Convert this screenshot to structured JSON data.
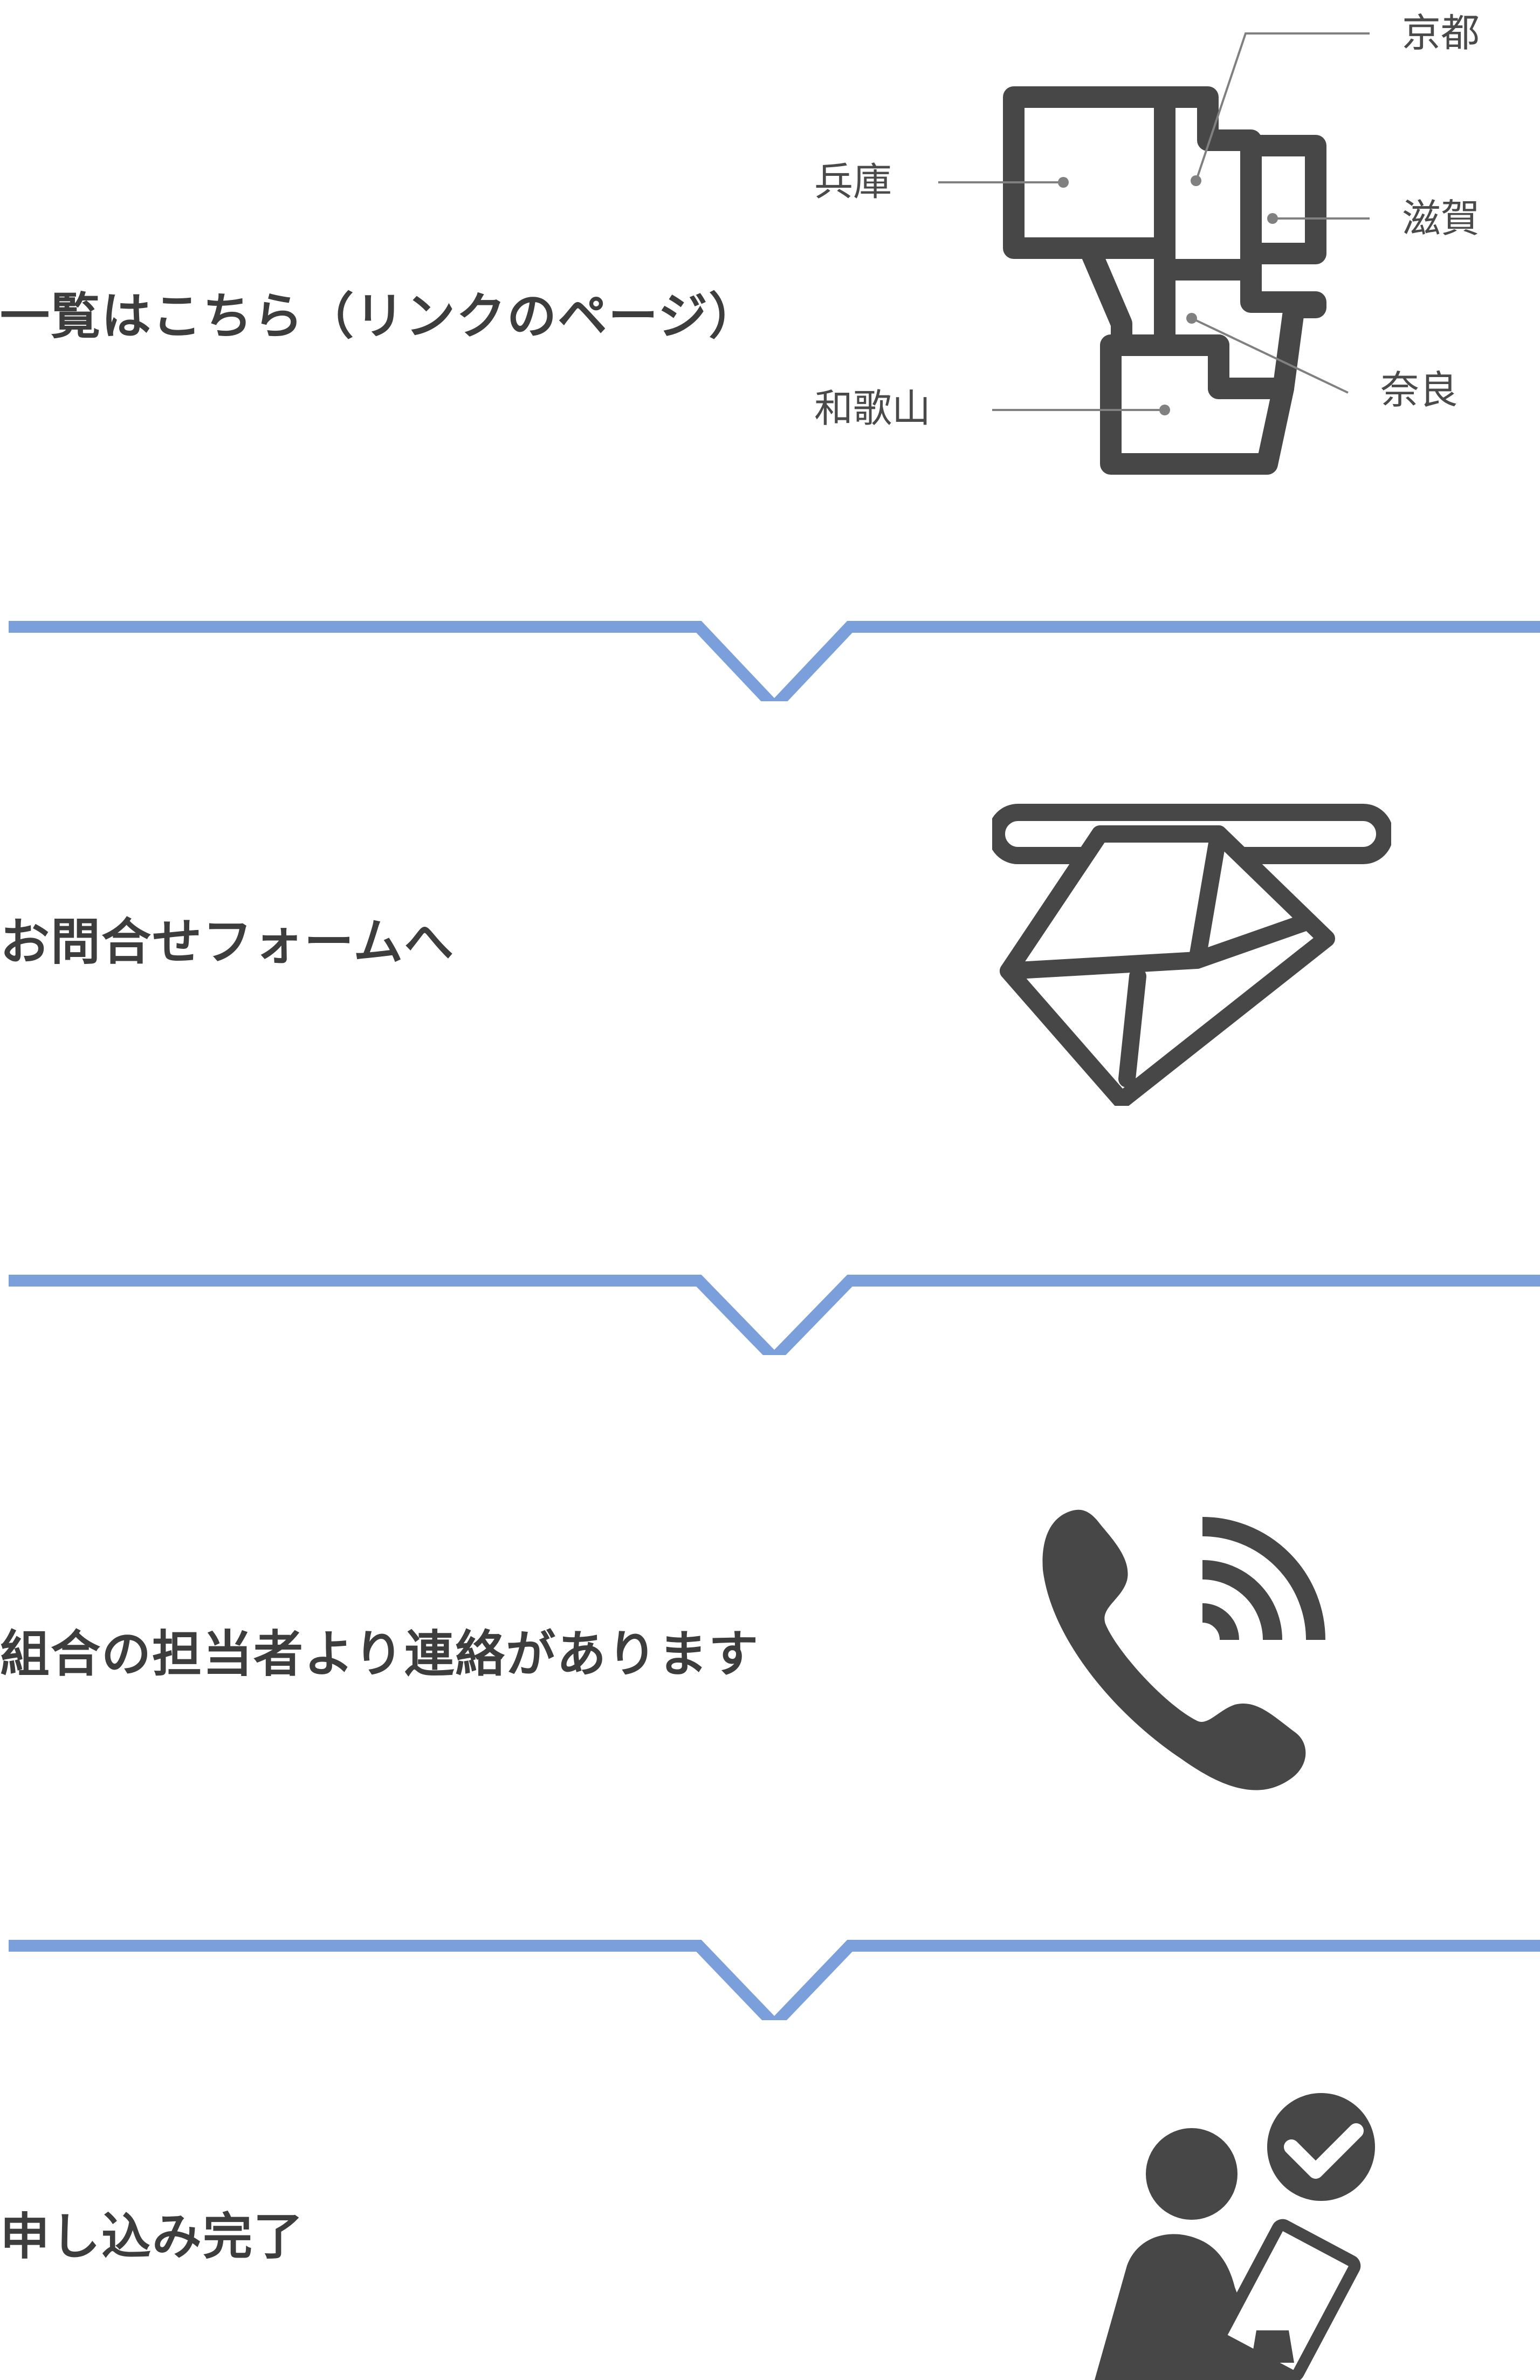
{
  "steps": [
    {
      "label": "一覧はこちら（リンクのページ）",
      "icon": "kansai-map-icon"
    },
    {
      "label": "お問合せフォームへ",
      "icon": "envelope-icon"
    },
    {
      "label": "組合の担当者より連絡があります",
      "icon": "phone-icon"
    },
    {
      "label": "申し込み完了",
      "icon": "person-checklist-icon"
    }
  ],
  "map": {
    "labels": {
      "kyoto": "京都",
      "hyogo": "兵庫",
      "shiga": "滋賀",
      "nara": "奈良",
      "wakayama": "和歌山"
    }
  },
  "colors": {
    "text": "#3d3d3d",
    "icon": "#474747",
    "divider": "#7b9fdb",
    "leader": "#808080"
  }
}
